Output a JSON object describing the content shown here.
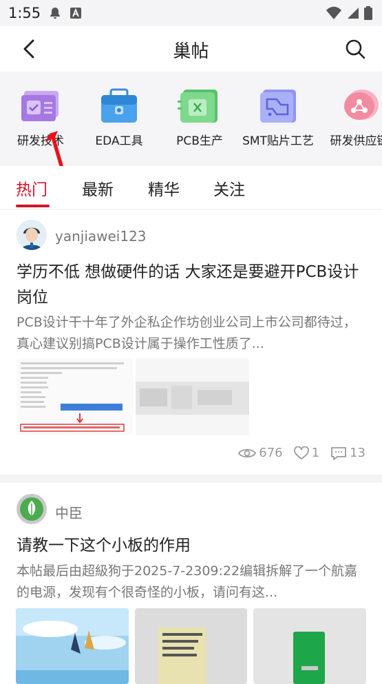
{
  "status_bar": {
    "time": "1:55"
  },
  "header": {
    "title": "巢帖"
  },
  "categories": [
    {
      "label": "研发技术",
      "icon": "chip-design-icon"
    },
    {
      "label": "EDA工具",
      "icon": "toolbox-icon"
    },
    {
      "label": "PCB生产",
      "icon": "pcb-board-icon"
    },
    {
      "label": "SMT贴片工艺",
      "icon": "smt-icon"
    },
    {
      "label": "研发供应链",
      "icon": "supply-chain-icon"
    }
  ],
  "tabs": [
    {
      "label": "热门",
      "active": true
    },
    {
      "label": "最新",
      "active": false
    },
    {
      "label": "精华",
      "active": false
    },
    {
      "label": "关注",
      "active": false
    }
  ],
  "posts": [
    {
      "author": "yanjiawei123",
      "title": "学历不低 想做硬件的话 大家还是要避开PCB设计岗位",
      "excerpt": "PCB设计干十年了外企私企作坊创业公司上市公司都待过，真心建议别搞PCB设计属于操作工性质了...",
      "views": "676",
      "likes": "1",
      "comments": "13"
    },
    {
      "author": "中臣",
      "title": "请教一下这个小板的作用",
      "excerpt": "本帖最后由超級狗于2025-7-2309:22编辑拆解了一个航嘉的电源，发现有个很奇怪的小板，请问有这..."
    }
  ],
  "colors": {
    "accent": "#d0142b",
    "muted": "#777777"
  }
}
